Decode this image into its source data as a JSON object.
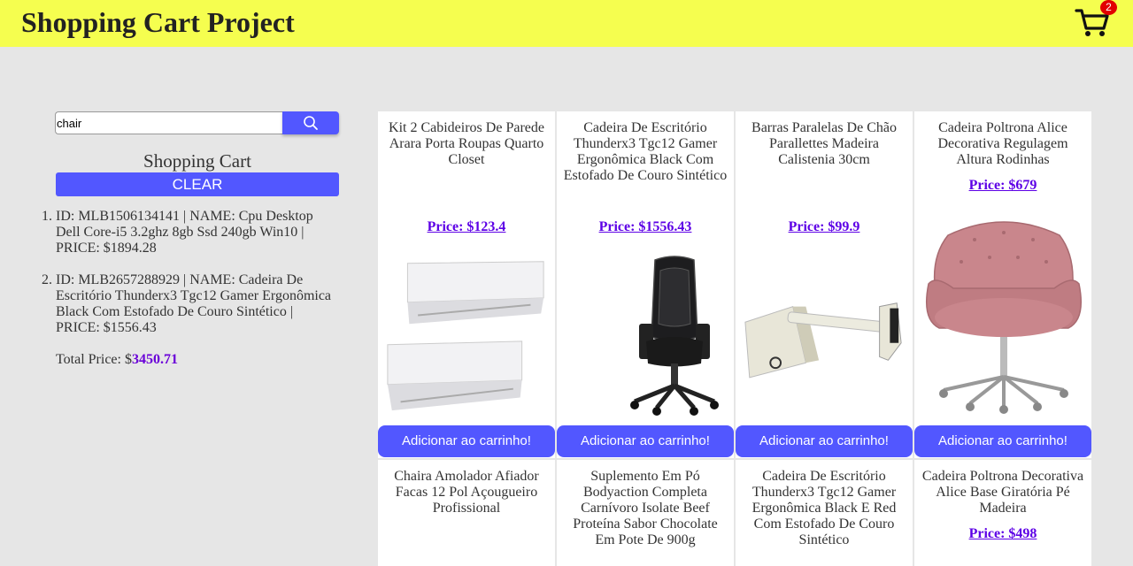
{
  "header": {
    "title": "Shopping Cart Project",
    "cart_count": "2"
  },
  "search": {
    "value": "chair"
  },
  "cart": {
    "title": "Shopping Cart",
    "clear_label": "CLEAR",
    "items": [
      "ID: MLB1506134141 | NAME: Cpu Desktop Dell Core-i5 3.2ghz 8gb Ssd 240gb Win10 | PRICE: $1894.28",
      "ID: MLB2657288929 | NAME: Cadeira De Escritório Thunderx3 Tgc12 Gamer Ergonômica Black Com Estofado De Couro Sintético | PRICE: $1556.43"
    ],
    "total_label": "Total Price: $",
    "total_value": "3450.71"
  },
  "products": [
    {
      "title": "Kit 2 Cabideiros De Parede Arara Porta Roupas Quarto Closet",
      "price": "Price: $123.4",
      "button": "Adicionar ao carrinho!",
      "image": "white-wall-rack"
    },
    {
      "title": "Cadeira De Escritório Thunderx3 Tgc12 Gamer Ergonômica Black Com Estofado De Couro Sintético",
      "price": "Price: $1556.43",
      "button": "Adicionar ao carrinho!",
      "image": "black-gaming-chair"
    },
    {
      "title": "Barras Paralelas De Chão Parallettes Madeira Calistenia 30cm",
      "price": "Price: $99.9",
      "button": "Adicionar ao carrinho!",
      "image": "parallettes"
    },
    {
      "title": "Cadeira Poltrona Alice Decorativa Regulagem Altura Rodinhas",
      "price": "Price: $679",
      "button": "Adicionar ao carrinho!",
      "image": "pink-armchair"
    },
    {
      "title": "Chaira Amolador Afiador Facas 12 Pol Açougueiro Profissional",
      "price": "",
      "button": "",
      "image": ""
    },
    {
      "title": "Suplemento Em Pó Bodyaction Completa Carnívoro Isolate Beef Proteína Sabor Chocolate Em Pote De 900g",
      "price": "",
      "button": "",
      "image": ""
    },
    {
      "title": "Cadeira De Escritório Thunderx3 Tgc12 Gamer Ergonômica Black E Red Com Estofado De Couro Sintético",
      "price": "",
      "button": "",
      "image": ""
    },
    {
      "title": "Cadeira Poltrona Decorativa Alice Base Giratória Pé Madeira",
      "price": "Price: $498",
      "button": "",
      "image": ""
    }
  ],
  "colors": {
    "header_bg": "#f5fe4f",
    "accent": "#5257ff",
    "price": "#5d00e6",
    "badge": "#e20000"
  }
}
